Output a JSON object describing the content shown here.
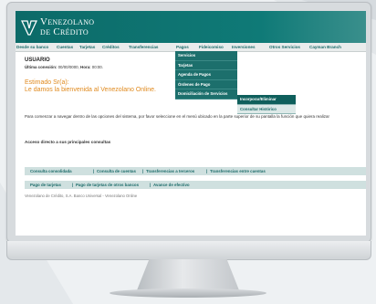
{
  "brand": {
    "line1": "Venezolano",
    "line2": "de Crédito"
  },
  "menu": {
    "items": [
      "Desde su banco",
      "Cuentas",
      "Tarjetas",
      "Créditos",
      "Transferencias",
      "Pagos",
      "Fideicomiso",
      "Inversiones",
      "Otros Servicios",
      "Cayman Branch"
    ]
  },
  "pagos_dropdown": [
    "Servicios",
    "Tarjetas",
    "Agenda de Pagos",
    "Órdenes de Pago",
    "Domiciliación de Servicios"
  ],
  "domiciliacion_submenu": [
    "Incorporar/Eliminar",
    "Consultar Histórico"
  ],
  "user": {
    "heading": "USUARIO",
    "last_conn_label": "Última conexión:",
    "last_conn_date": "00/00/0000,",
    "hora_label": "Hora:",
    "hora_value": "00:00."
  },
  "greeting": {
    "line1": "Estimado Sr(a):",
    "line2": "Le damos la bienvenida al Venezolano Online."
  },
  "intro_text": "Para comenzar a navegar dentro de las opciones del sistema, por favor seleccione en el menú ubicado en la parte superior de su pantalla la función que quiera realizar",
  "quick_access": {
    "title": "Acceso directo a sus principales consultas",
    "row1": [
      "Consulta consolidada",
      "Consulta de cuentas",
      "Transferencias a terceros",
      "Transferencias entre cuentas"
    ],
    "row2": [
      "Pago de tarjetas",
      "Pago de tarjetas de otros bancos",
      "Avance de efectivo"
    ],
    "separator": "|"
  },
  "footer_text": "Venezolano de Crédito, S.A. Banco Universal - Venezolano Online",
  "colors": {
    "brand": "#0f7a77",
    "greeting": "#e08a1e",
    "menu_text": "#1b6b69"
  }
}
